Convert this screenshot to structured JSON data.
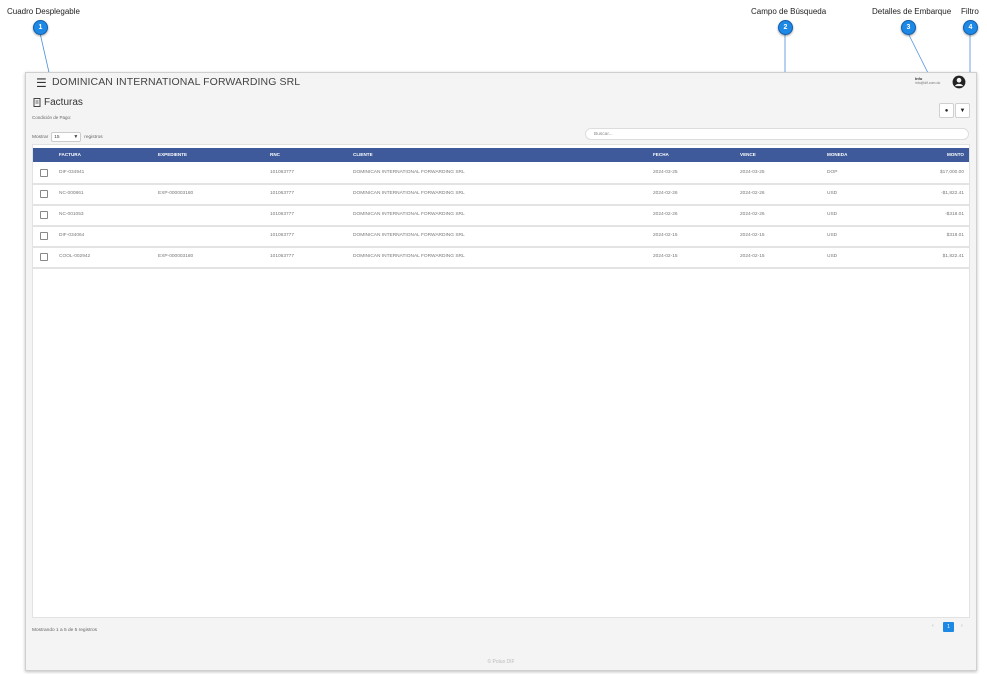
{
  "callouts": [
    {
      "num": "1",
      "label": "Cuadro Desplegable"
    },
    {
      "num": "2",
      "label": "Campo de Búsqueda"
    },
    {
      "num": "3",
      "label": "Detalles de Embarque"
    },
    {
      "num": "4",
      "label": "Filtro"
    }
  ],
  "app": {
    "menu_icon": "☰",
    "company": "DOMINICAN INTERNATIONAL FORWARDING SRL",
    "user_name": "Info",
    "user_email": "info@dif.com.do",
    "page_title": "Facturas",
    "condition_label": "Condición de Pago:",
    "show_label": "Mostrar",
    "show_value": "15",
    "records_label": "registros",
    "search_placeholder": "Buscar...",
    "details_icon": "●",
    "filter_icon": "▼"
  },
  "table": {
    "headers": [
      "FACTURA",
      "EXPEDIENTE",
      "RNC",
      "CLIENTE",
      "FECHA",
      "VENCE",
      "MONEDA",
      "MONTO"
    ],
    "rows": [
      [
        "DIF-034941",
        "",
        "101063777",
        "DOMINICAN INTERNATIONAL FORWARDING SRL",
        "2024-03-25",
        "2024-03-25",
        "DOP",
        "$17,000.00"
      ],
      [
        "NC-000861",
        "EXP-000003180",
        "101063777",
        "DOMINICAN INTERNATIONAL FORWARDING SRL",
        "2024-02-26",
        "2024-02-26",
        "USD",
        "-$1,822.41"
      ],
      [
        "NC-001053",
        "",
        "101063777",
        "DOMINICAN INTERNATIONAL FORWARDING SRL",
        "2024-02-26",
        "2024-02-26",
        "USD",
        "-$318.01"
      ],
      [
        "DIF-034064",
        "",
        "101063777",
        "DOMINICAN INTERNATIONAL FORWARDING SRL",
        "2024-02-15",
        "2024-02-15",
        "USD",
        "$318.01"
      ],
      [
        "COOL-002942",
        "EXP-000003180",
        "101063777",
        "DOMINICAN INTERNATIONAL FORWARDING SRL",
        "2024-02-15",
        "2024-02-15",
        "USD",
        "$1,822.41"
      ]
    ]
  },
  "footer": {
    "info": "Mostrando 1 a 5 de 5 registros",
    "prev": "‹",
    "page": "1",
    "next": "›",
    "copyright": "© Polus DIF"
  },
  "colors": {
    "header": "#3e5a9a",
    "callout": "#1e88e5"
  }
}
